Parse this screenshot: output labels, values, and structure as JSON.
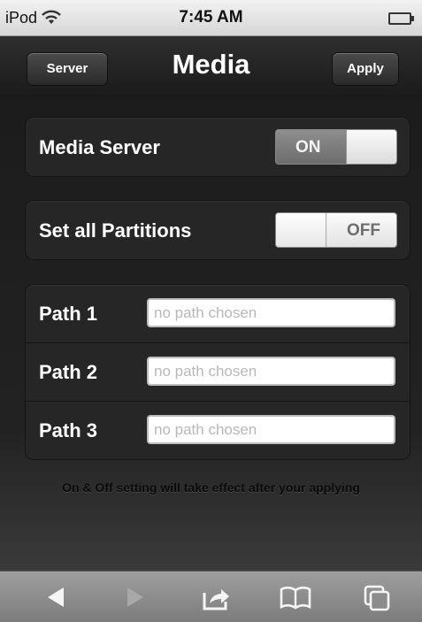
{
  "status": {
    "carrier": "iPod",
    "time": "7:45 AM"
  },
  "nav": {
    "back_label": "Server",
    "title": "Media",
    "apply_label": "Apply"
  },
  "settings": {
    "media_server": {
      "label": "Media Server",
      "state": "ON"
    },
    "set_all_partitions": {
      "label": "Set all Partitions",
      "state": "OFF"
    }
  },
  "paths": [
    {
      "label": "Path 1",
      "value": "",
      "placeholder": "no path chosen"
    },
    {
      "label": "Path 2",
      "value": "",
      "placeholder": "no path chosen"
    },
    {
      "label": "Path 3",
      "value": "",
      "placeholder": "no path chosen"
    }
  ],
  "note": "On & Off setting will take effect after your applying",
  "toolbar": {
    "icons": [
      "back-arrow-icon",
      "forward-arrow-icon",
      "share-icon",
      "bookmarks-icon",
      "pages-icon"
    ]
  },
  "colors": {
    "background": "#1e1e1e",
    "toolbar": "#8c8c8c",
    "status_bar": "#e4e4e4"
  }
}
